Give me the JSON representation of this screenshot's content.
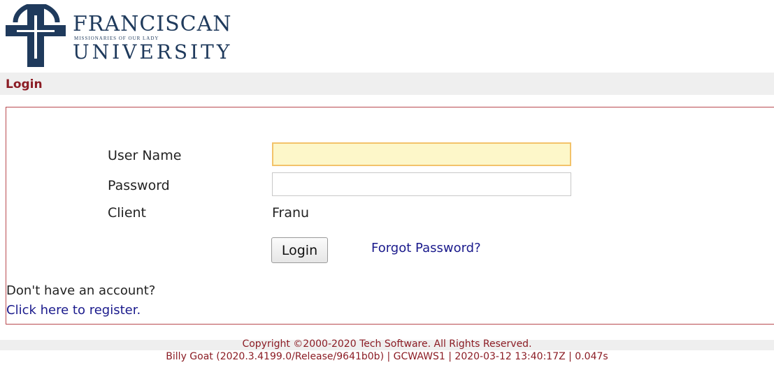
{
  "logo": {
    "line1": "FRANCISCAN",
    "line2": "MISSIONARIES OF OUR LADY",
    "line3": "UNIVERSITY"
  },
  "page": {
    "title": "Login"
  },
  "form": {
    "username_label": "User Name",
    "username_value": "",
    "password_label": "Password",
    "password_value": "",
    "client_label": "Client",
    "client_value": "Franu",
    "login_button": "Login",
    "forgot_link": "Forgot Password?"
  },
  "register": {
    "prompt": "Don't have an account?",
    "link": "Click here to register."
  },
  "footer": {
    "copyright": "Copyright ©2000-2020 Tech Software. All Rights Reserved.",
    "build": "Billy Goat (2020.3.4199.0/Release/9641b0b) | GCWAWS1 | 2020-03-12 13:40:17Z | 0.047s"
  },
  "colors": {
    "brand_navy": "#1f3a5c",
    "accent_maroon": "#8b1c24",
    "link_blue": "#1a1a8c"
  }
}
